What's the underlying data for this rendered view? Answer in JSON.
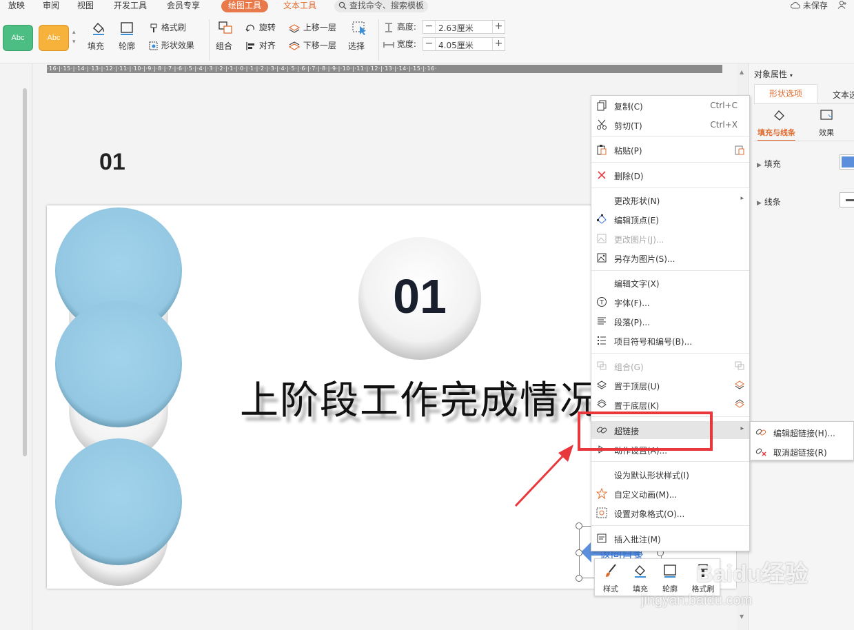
{
  "tabs": {
    "t1": "放映",
    "t2": "审阅",
    "t3": "视图",
    "t4": "开发工具",
    "t5": "会员专享",
    "drawing_tools": "绘图工具",
    "text_tools": "文本工具"
  },
  "search": {
    "placeholder": "查找命令、搜索模板"
  },
  "top_right": {
    "unsaved": "未保存",
    "share_prefix": ""
  },
  "ribbon": {
    "style1": "Abc",
    "style2": "Abc",
    "format_brush": "格式刷",
    "fill": "填充",
    "outline": "轮廓",
    "shape_effect": "形状效果",
    "group": "组合",
    "rotate": "旋转",
    "align": "对齐",
    "bring_forward": "上移一层",
    "send_backward": "下移一层",
    "select": "选择",
    "height_label": "高度:",
    "height_value": "2.63厘米",
    "width_label": "宽度:",
    "width_value": "4.05厘米"
  },
  "ruler": {
    "text": "·16·|·15·|·14·|·13·|·12·|·11·|·10·|·9·|·8·|·7·|·6·|·5·|·4·|·3·|·2·|·1·|·0·|·1·|·2·|·3·|·4·|·5·|·6·|·7·|·8·|·9·|·10·|·11·|·12·|·13·|·14·|·15·|·16·"
  },
  "slide": {
    "number_label": "01",
    "badge_number": "01",
    "title": "上阶段工作完成情况",
    "return_label": "返回目录"
  },
  "context_menu": {
    "copy": "复制(C)",
    "copy_sc": "Ctrl+C",
    "cut": "剪切(T)",
    "cut_sc": "Ctrl+X",
    "paste": "粘贴(P)",
    "delete": "删除(D)",
    "change_shape": "更改形状(N)",
    "edit_points": "编辑顶点(E)",
    "change_picture": "更改图片(J)...",
    "save_as_picture": "另存为图片(S)...",
    "edit_text": "编辑文字(X)",
    "font": "字体(F)...",
    "paragraph": "段落(P)...",
    "bullets": "项目符号和编号(B)...",
    "group": "组合(G)",
    "bring_to_front": "置于顶层(U)",
    "send_to_back": "置于底层(K)",
    "hyperlink": "超链接",
    "action_settings": "动作设置(A)...",
    "set_default_style": "设为默认形状样式(I)",
    "custom_animation": "自定义动画(M)...",
    "format_object": "设置对象格式(O)...",
    "insert_comment": "插入批注(M)"
  },
  "submenu": {
    "edit_hyperlink": "编辑超链接(H)...",
    "remove_hyperlink": "取消超链接(R)"
  },
  "mini_toolbar": {
    "style": "样式",
    "fill": "填充",
    "outline": "轮廓",
    "format_brush": "格式刷"
  },
  "right_panel": {
    "title": "对象属性",
    "tab_shape": "形状选项",
    "tab_text": "文本选",
    "fill_line": "填充与线条",
    "effects": "效果",
    "fill": "填充",
    "line": "线条"
  },
  "watermark": {
    "brand": "Baidu经验",
    "url": "jingyan.baidu.com"
  },
  "colors": {
    "accent_orange": "#e8794a",
    "highlight_red": "#e8383d",
    "circle_blue": "#9ccfe8",
    "fill_swatch": "#5b8fdc"
  }
}
